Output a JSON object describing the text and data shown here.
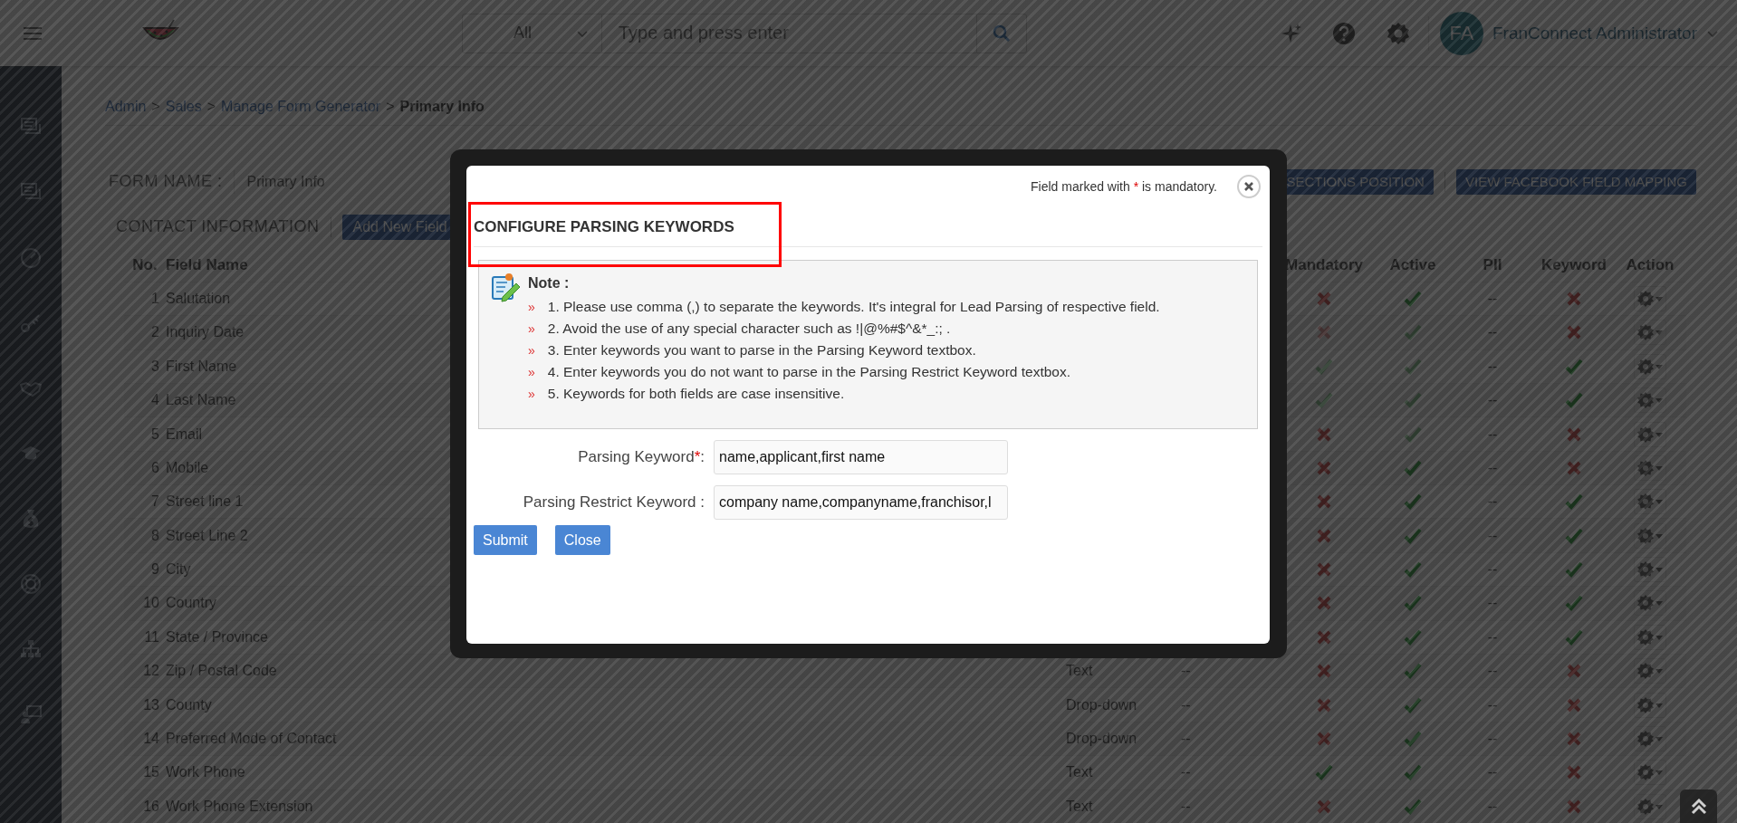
{
  "header": {
    "search_scope": "All",
    "search_placeholder": "Type and press enter",
    "avatar_initials": "FA",
    "user_name": "FranConnect Administrator"
  },
  "breadcrumb": [
    {
      "text": "Admin",
      "kind": "link"
    },
    {
      "text": ">",
      "kind": "separator"
    },
    {
      "text": "Sales",
      "kind": "link"
    },
    {
      "text": ">",
      "kind": "separator"
    },
    {
      "text": "Manage Form Generator",
      "kind": "link"
    },
    {
      "text": ">",
      "kind": "separator"
    },
    {
      "text": "Primary Info",
      "kind": "current"
    }
  ],
  "form": {
    "label": "FORM NAME :",
    "value": "Primary Info"
  },
  "top_buttons": [
    "SECTIONS POSITION",
    "VIEW FACEBOOK FIELD MAPPING"
  ],
  "section": {
    "title": "CONTACT INFORMATION",
    "button": "Add New Field"
  },
  "table": {
    "columns": [
      {
        "label": "No."
      },
      {
        "label": "Field Name"
      },
      {
        "label": "Mandatory"
      },
      {
        "label": "Active"
      },
      {
        "label": "PII"
      },
      {
        "label": "Keyword"
      },
      {
        "label": "Action"
      }
    ],
    "rows": [
      {
        "no": "1",
        "field_name": "Salutation",
        "mandatory": false,
        "mandatory_dimmed": false,
        "active": true,
        "active_dimmed": false,
        "pii": "--",
        "keyword": false
      },
      {
        "no": "2",
        "field_name": "Inquiry Date",
        "mandatory": false,
        "mandatory_dimmed": true,
        "active": true,
        "active_dimmed": true,
        "pii": "--",
        "keyword": false
      },
      {
        "no": "3",
        "field_name": "First Name",
        "mandatory": true,
        "mandatory_dimmed": true,
        "active": true,
        "active_dimmed": true,
        "pii": "--",
        "keyword": true
      },
      {
        "no": "4",
        "field_name": "Last Name",
        "mandatory": true,
        "mandatory_dimmed": true,
        "active": true,
        "active_dimmed": true,
        "pii": "--",
        "keyword": true
      },
      {
        "no": "5",
        "field_name": "Email",
        "mandatory": false,
        "mandatory_dimmed": false,
        "active": true,
        "active_dimmed": true,
        "pii": "--",
        "keyword": false
      },
      {
        "no": "6",
        "field_name": "Mobile",
        "mandatory": false,
        "mandatory_dimmed": false,
        "active": true,
        "active_dimmed": false,
        "pii": "--",
        "keyword": false
      },
      {
        "no": "7",
        "field_name": "Street line 1",
        "mandatory": false,
        "mandatory_dimmed": false,
        "active": true,
        "active_dimmed": false,
        "pii": "--",
        "keyword": true
      },
      {
        "no": "8",
        "field_name": "Street Line 2",
        "mandatory": false,
        "mandatory_dimmed": false,
        "active": true,
        "active_dimmed": false,
        "pii": "--",
        "keyword": true
      },
      {
        "no": "9",
        "field_name": "City",
        "mandatory": false,
        "mandatory_dimmed": false,
        "active": true,
        "active_dimmed": false,
        "pii": "--",
        "keyword": true
      },
      {
        "no": "10",
        "field_name": "Country",
        "mandatory": false,
        "mandatory_dimmed": false,
        "active": true,
        "active_dimmed": false,
        "pii": "--",
        "keyword": true
      },
      {
        "no": "11",
        "field_name": "State / Province",
        "mandatory": false,
        "mandatory_dimmed": false,
        "active": true,
        "active_dimmed": false,
        "pii": "--",
        "keyword": true
      },
      {
        "no": "12",
        "field_name": "Zip / Postal Code",
        "column_3": "Text",
        "column_4": "--",
        "mandatory": false,
        "mandatory_dimmed": false,
        "active": true,
        "active_dimmed": false,
        "pii": "--",
        "keyword": false
      },
      {
        "no": "13",
        "field_name": "County",
        "column_3": "Drop-down",
        "column_4": "--",
        "mandatory": false,
        "mandatory_dimmed": false,
        "active": true,
        "active_dimmed": false,
        "pii": "--",
        "keyword": false
      },
      {
        "no": "14",
        "field_name": "Preferred Mode of Contact",
        "column_3": "Drop-down",
        "column_4": "--",
        "mandatory": false,
        "mandatory_dimmed": false,
        "active": true,
        "active_dimmed": false,
        "pii": "--",
        "keyword": false
      },
      {
        "no": "15",
        "field_name": "Work Phone",
        "column_3": "Text",
        "column_4": "--",
        "mandatory": true,
        "mandatory_dimmed": false,
        "active": true,
        "active_dimmed": false,
        "pii": "--",
        "keyword": false
      },
      {
        "no": "16",
        "field_name": "Work Phone Extension",
        "column_3": "Text",
        "column_4": "--",
        "mandatory": false,
        "mandatory_dimmed": false,
        "active": true,
        "active_dimmed": false,
        "pii": "--",
        "keyword": false
      }
    ]
  },
  "modal": {
    "note_before": "Field marked with",
    "note_star": "*",
    "note_after": "is mandatory.",
    "title": "CONFIGURE PARSING KEYWORDS",
    "title_highlighted": true,
    "note_heading": "Note :",
    "notes": [
      {
        "bullet": "»",
        "text": "1. Please use comma (,) to separate the keywords. It's integral for Lead Parsing of respective field."
      },
      {
        "bullet": "»",
        "text": "2. Avoid the use of any special character such as !|@%#$^&*_:; ."
      },
      {
        "bullet": "»",
        "text": "3. Enter keywords you want to parse in the Parsing Keyword textbox."
      },
      {
        "bullet": "»",
        "text": "4. Enter keywords you do not want to parse in the Parsing Restrict Keyword textbox."
      },
      {
        "bullet": "»",
        "text": "5. Keywords for both fields are case insensitive."
      }
    ],
    "fields": [
      {
        "label": "Parsing Keyword",
        "mark": "*",
        "colon": ":",
        "value": "name,applicant,first name"
      },
      {
        "label": "Parsing Restrict Keyword",
        "colon": " :",
        "value": "company name,companyname,franchisor,l"
      }
    ],
    "buttons": [
      "Submit",
      "Close"
    ]
  }
}
